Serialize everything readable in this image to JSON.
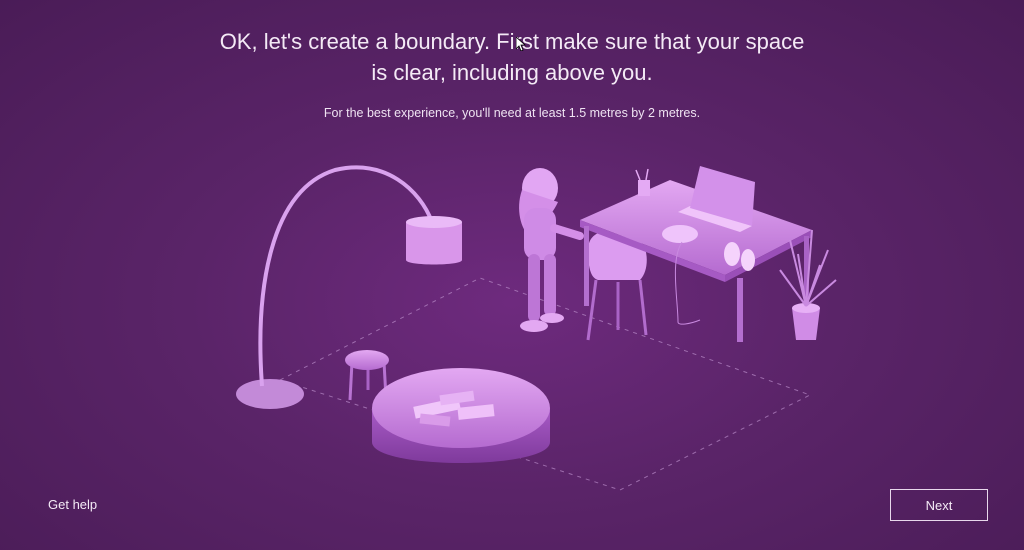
{
  "setup": {
    "headline_line1": "OK, let's create a boundary. First make sure that your space",
    "headline_line2": "is clear, including above you.",
    "subtitle": "For the best experience, you'll need at least 1.5 metres by 2 metres."
  },
  "footer": {
    "help_label": "Get help",
    "next_label": "Next"
  },
  "colors": {
    "background": "#5a2468",
    "illustration": "#c77fe0",
    "boundary_line": "#b98bc9"
  }
}
